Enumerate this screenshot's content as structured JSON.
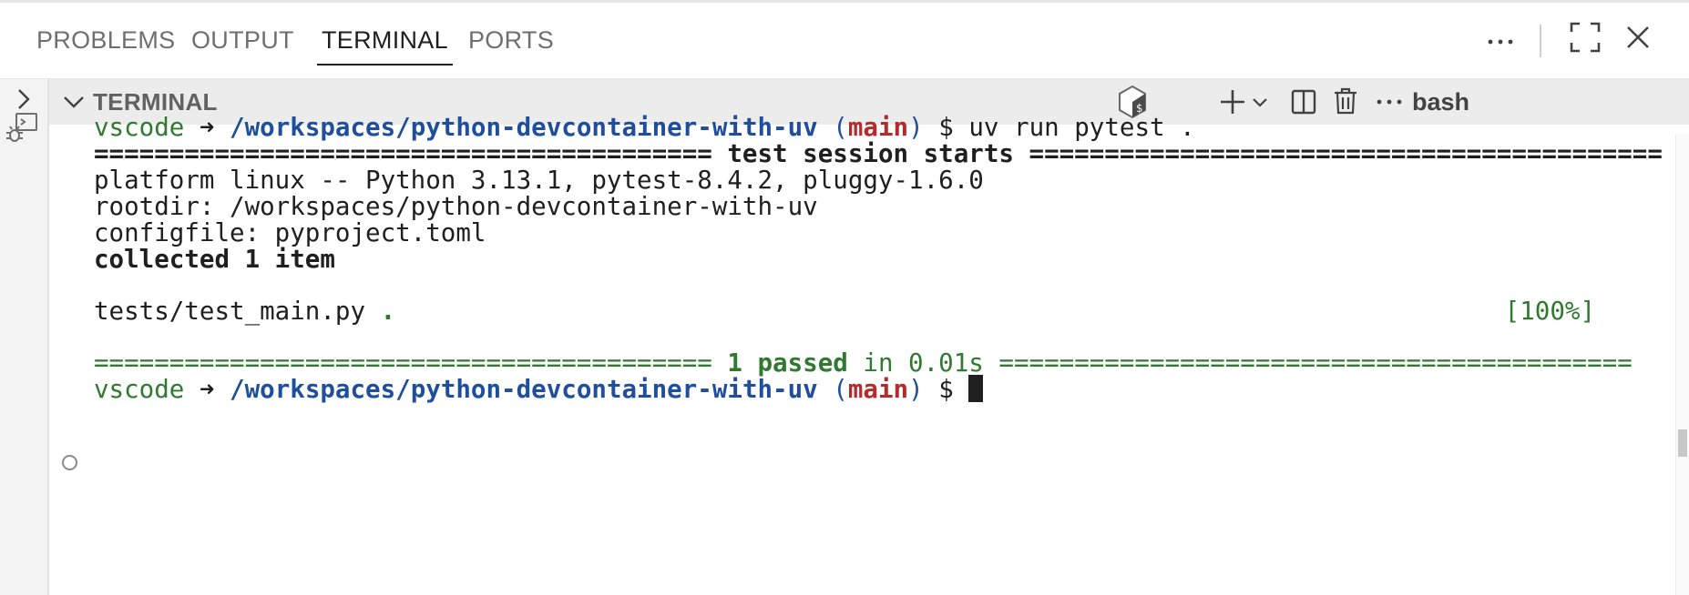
{
  "tabs": [
    {
      "label": "PROBLEMS",
      "active": false
    },
    {
      "label": "OUTPUT",
      "active": false
    },
    {
      "label": "TERMINAL",
      "active": true
    },
    {
      "label": "PORTS",
      "active": false
    }
  ],
  "tabbar_icons": [
    "more-actions-icon",
    "maximize-panel-icon",
    "close-panel-icon"
  ],
  "terminal_header": {
    "title": "TERMINAL",
    "shell_name": "bash",
    "icons": [
      "chevron-down-icon",
      "bash-shell-icon",
      "new-terminal-plus-icon",
      "launch-profile-chevron-icon",
      "split-terminal-icon",
      "kill-terminal-trash-icon",
      "more-actions-icon"
    ]
  },
  "left_strip_icons": [
    "chevron-right-icon",
    "debug-console-icon"
  ],
  "terminal": {
    "prompt1": {
      "user": "vscode",
      "arrow": "➜",
      "path": "/workspaces/python-devcontainer-with-uv",
      "branch_open": "(",
      "branch": "main",
      "branch_close": ")",
      "dollar": "$",
      "command": "uv run pytest ."
    },
    "session_rule_left": "=========================================",
    "session_title": "test session starts",
    "session_rule_right": "==========================================",
    "platform_line": "platform linux -- Python 3.13.1, pytest-8.4.2, pluggy-1.6.0",
    "rootdir_line": "rootdir: /workspaces/python-devcontainer-with-uv",
    "configfile_line": "configfile: pyproject.toml",
    "collected_line": "collected 1 item",
    "test_file": "tests/test_main.py",
    "test_dot": ".",
    "test_percent": "[100%]",
    "result_rule_left": "=========================================",
    "result_passed": "1 passed",
    "result_in": "in 0.01s",
    "result_rule_right": "==========================================",
    "prompt2": {
      "user": "vscode",
      "arrow": "➜",
      "path": "/workspaces/python-devcontainer-with-uv",
      "branch_open": "(",
      "branch": "main",
      "branch_close": ")",
      "dollar": "$"
    }
  },
  "colors": {
    "prompt_user": "#2f7a2f",
    "path": "#1f4f9c",
    "branch": "#b52a2a",
    "pass": "#2f7a2f"
  }
}
